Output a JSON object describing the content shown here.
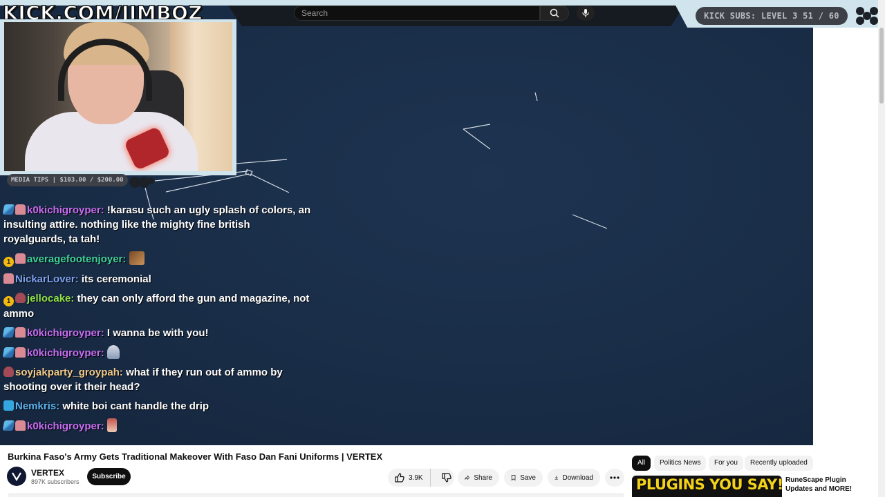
{
  "overlay": {
    "channel_url": "KICK.COM/JIMBOZ",
    "search": {
      "placeholder": "Search"
    },
    "subs_goal": "KICK SUBS: LEVEL 3 51 / 60",
    "media_tips": "MEDIA TIPS | $103.00 / $200.00"
  },
  "chat": [
    {
      "badges": [
        "sword",
        "sub"
      ],
      "user": "k0kichigroyper",
      "color": "#c86cf0",
      "text": "!karasu such an ugly splash of colors, an insulting attire. nothing like the mighty fine british royalguards, ta tah!"
    },
    {
      "badges": [
        "one",
        "sub"
      ],
      "user": "averagefootenjoyer",
      "color": "#3fd29a",
      "text": "",
      "emote": "dog"
    },
    {
      "badges": [
        "sub"
      ],
      "user": "NickarLover",
      "color": "#7ea2f0",
      "text": "its ceremonial"
    },
    {
      "badges": [
        "one",
        "hat"
      ],
      "user": "jellocake",
      "color": "#8fe04a",
      "text": "they can only afford the gun and magazine, not ammo"
    },
    {
      "badges": [
        "sword",
        "sub"
      ],
      "user": "k0kichigroyper",
      "color": "#c86cf0",
      "text": "I wanna be with you!"
    },
    {
      "badges": [
        "sword",
        "sub"
      ],
      "user": "k0kichigroyper",
      "color": "#c86cf0",
      "text": "",
      "emote": "robot"
    },
    {
      "badges": [
        "hat"
      ],
      "user": "soyjakparty_groypah",
      "color": "#f0c98a",
      "text": "what if they run out of ammo by shooting over it their head?"
    },
    {
      "badges": [
        "cube"
      ],
      "user": "Nemkris",
      "color": "#5ab4f0",
      "text": "white boi cant handle the drip"
    },
    {
      "badges": [
        "sword",
        "sub"
      ],
      "user": "k0kichigroyper",
      "color": "#c86cf0",
      "text": "",
      "emote": "small"
    }
  ],
  "video": {
    "title": "Burkina Faso's Army Gets Traditional Makeover With Faso Dan Fani Uniforms | VERTEX",
    "channel_name": "VERTEX",
    "channel_subs": "897K subscribers",
    "subscribe_label": "Subscribe",
    "likes": "3.9K",
    "share_label": "Share",
    "save_label": "Save",
    "download_label": "Download"
  },
  "sidebar": {
    "chips": [
      "All",
      "Politics News",
      "For you",
      "Recently uploaded"
    ],
    "active_chip": "All",
    "recommended": {
      "thumb_text": "PLUGINS YOU SAY!?",
      "title": "RuneScape Plugin Updates and MORE!"
    }
  },
  "colors": {
    "video_bg": "#1a2e49",
    "overlay_accent": "#cfe4ec",
    "pill_dark": "#3d4147"
  }
}
